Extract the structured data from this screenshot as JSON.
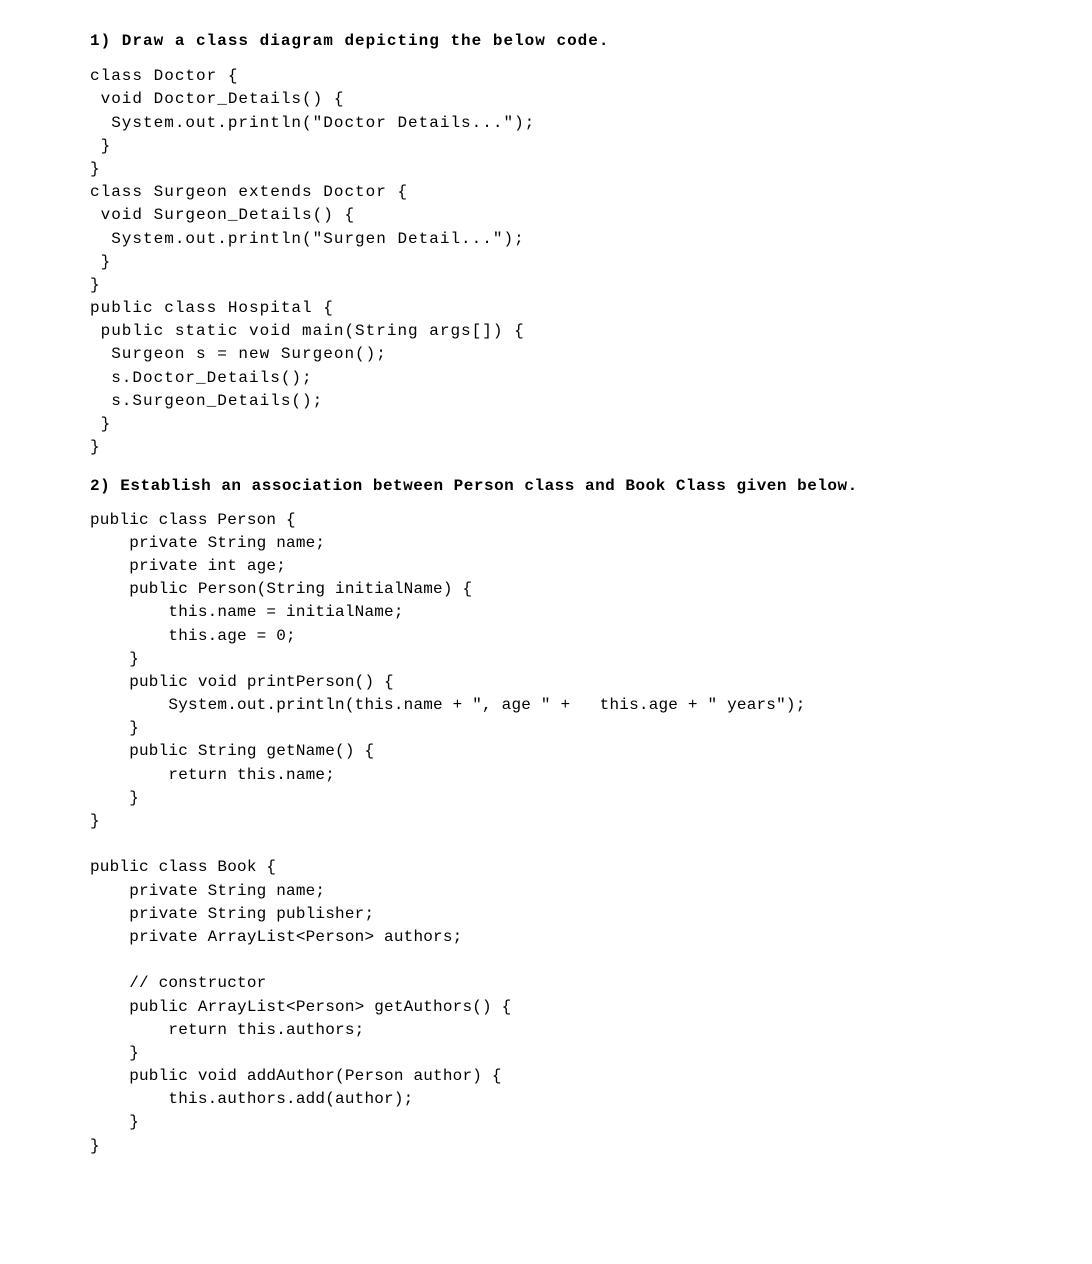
{
  "q1_heading": "1) Draw a class diagram depicting the below code.",
  "code1": "class Doctor {\n void Doctor_Details() {\n  System.out.println(\"Doctor Details...\");\n }\n}\nclass Surgeon extends Doctor {\n void Surgeon_Details() {\n  System.out.println(\"Surgen Detail...\");\n }\n}\npublic class Hospital {\n public static void main(String args[]) {\n  Surgeon s = new Surgeon();\n  s.Doctor_Details();\n  s.Surgeon_Details();\n }\n}",
  "q2_heading": "2) Establish an association between Person class and Book Class given below.",
  "code2": "public class Person {\n    private String name;\n    private int age;\n    public Person(String initialName) {\n        this.name = initialName;\n        this.age = 0;\n    }\n    public void printPerson() {\n        System.out.println(this.name + \", age \" +   this.age + \" years\");\n    }\n    public String getName() {\n        return this.name;\n    }\n}\n\npublic class Book {\n    private String name;\n    private String publisher;\n    private ArrayList<Person> authors;\n\n    // constructor\n    public ArrayList<Person> getAuthors() {\n        return this.authors;\n    }\n    public void addAuthor(Person author) {\n        this.authors.add(author);\n    }\n}"
}
